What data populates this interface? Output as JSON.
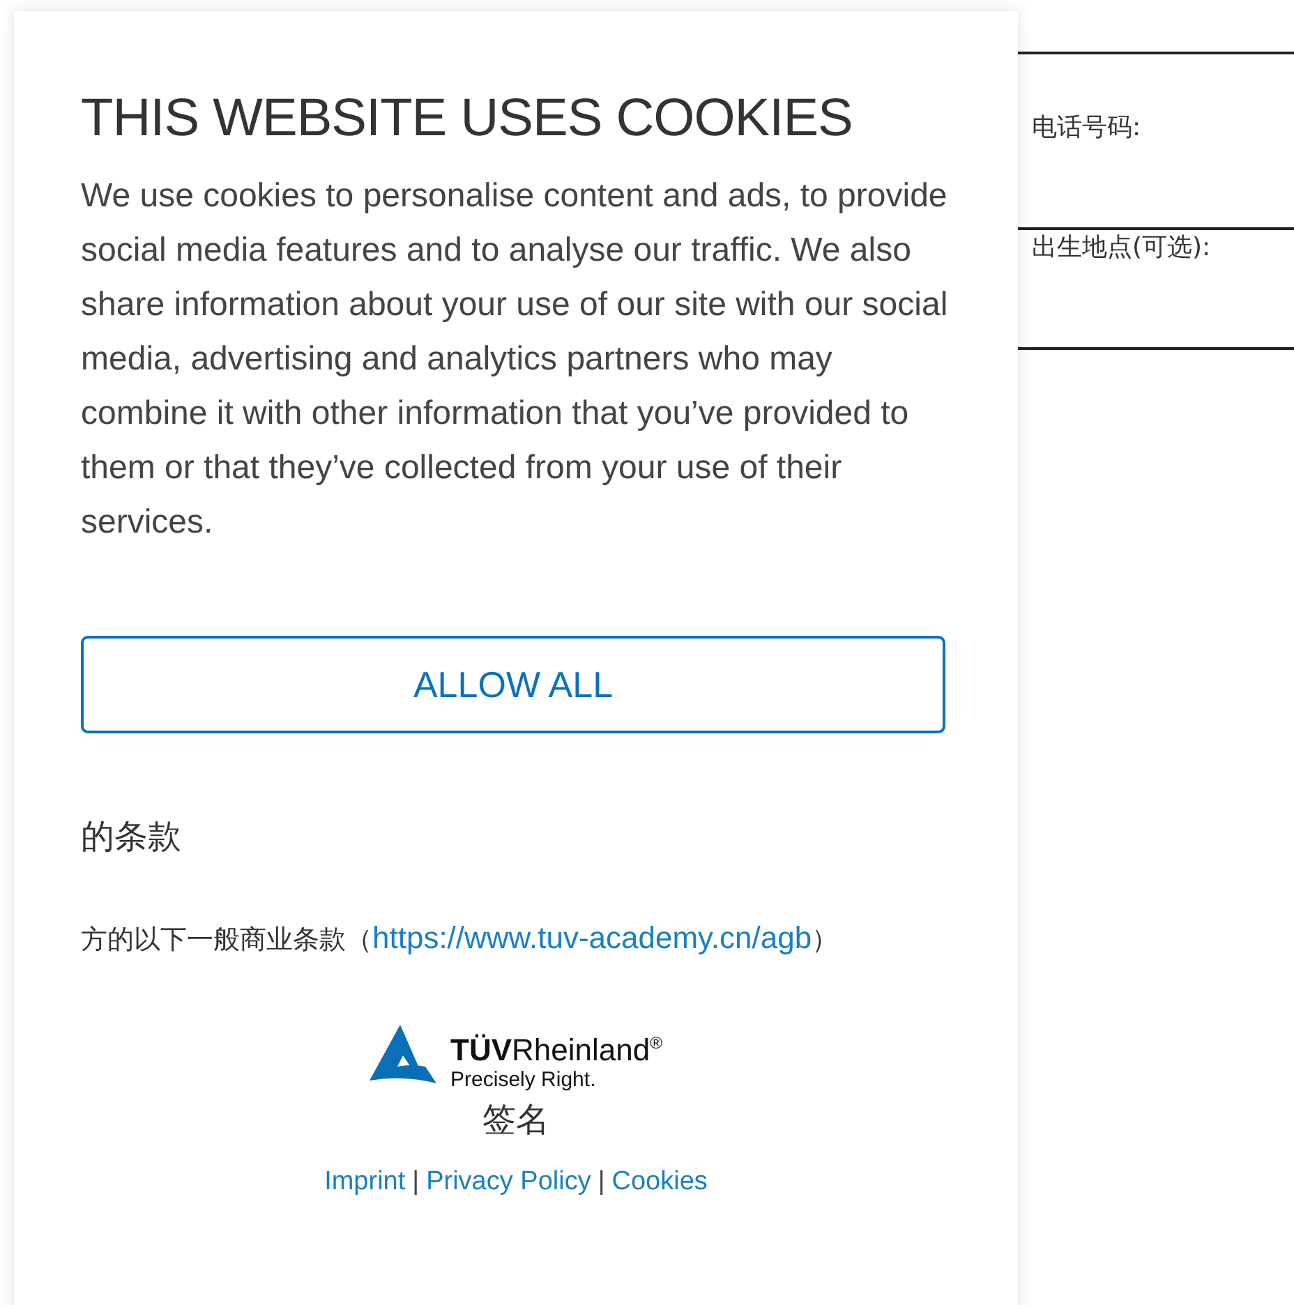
{
  "cookie_dialog": {
    "title": "THIS WEBSITE USES COOKIES",
    "text": "We use cookies to personalise content and ads, to provide social media features and to analyse our traffic. We also share information about your use of our site with our social media, advertising and analytics partners who may combine it with other information that you’ve provided to them or that they’ve collected from your use of their services.",
    "button": "ALLOW ALL"
  },
  "form": {
    "fields": [
      {
        "label": "电话号码:"
      },
      {
        "label": "出生地点(可选):"
      }
    ],
    "terms_heading": "的条款",
    "terms_text": "方的以下一般商业条款（",
    "terms_link": "https://www.tuv-academy.cn/agb",
    "terms_close": "）",
    "signature_label": "签名"
  },
  "logo": {
    "brand_bold": "TÜV",
    "brand": "Rheinland",
    "registered": "®",
    "tagline": "Precisely Right."
  },
  "footer": {
    "links": [
      "Imprint",
      "Privacy Policy",
      "Cookies"
    ],
    "separator": "|"
  }
}
